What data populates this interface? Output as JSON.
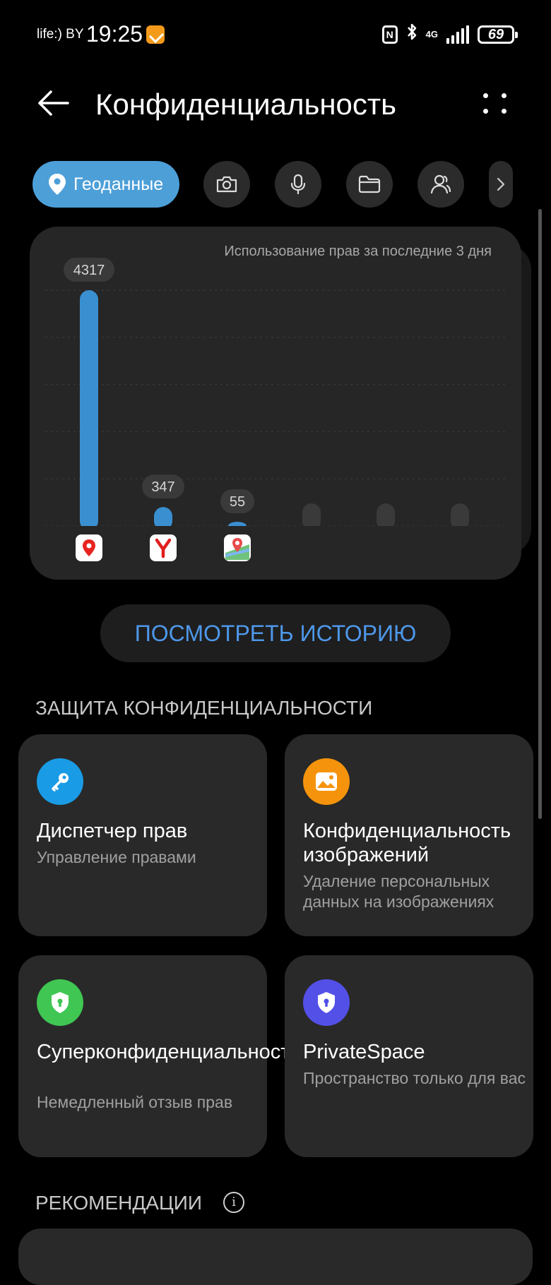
{
  "status_bar": {
    "carrier": "life:) BY",
    "time": "19:25",
    "network": "4G",
    "battery": "69"
  },
  "header": {
    "title": "Конфиденциальность"
  },
  "permission_tabs": {
    "active_label": "Геоданные",
    "items": [
      {
        "name": "location",
        "icon": "location-pin-icon",
        "active": true
      },
      {
        "name": "camera",
        "icon": "camera-icon"
      },
      {
        "name": "microphone",
        "icon": "microphone-icon"
      },
      {
        "name": "files",
        "icon": "folder-icon"
      },
      {
        "name": "contacts",
        "icon": "person-icon"
      }
    ]
  },
  "usage_chart": {
    "caption": "Использование прав за последние 3 дня",
    "bar_color": "#3a8fd0",
    "empty_bar_color": "#3a3a3a"
  },
  "chart_data": {
    "type": "bar",
    "title": "Использование прав за последние 3 дня",
    "categories": [
      "app-1-maps-pin",
      "app-2-yandex",
      "app-3-maps",
      "empty-4",
      "empty-5",
      "empty-6"
    ],
    "values": [
      4317,
      347,
      55,
      0,
      0,
      0
    ],
    "value_labels": [
      "4317",
      "347",
      "55",
      "",
      "",
      ""
    ],
    "ylim": [
      0,
      4317
    ],
    "grid": true
  },
  "history_button": {
    "label": "ПОСМОТРЕТЬ ИСТОРИЮ",
    "color": "#4e98ea"
  },
  "privacy_section": {
    "title": "ЗАЩИТА КОНФИДЕНЦИАЛЬНОСТИ",
    "tiles": [
      {
        "title": "Диспетчер прав",
        "subtitle": "Управление правами",
        "icon": "key-icon",
        "color": "#1a9be6"
      },
      {
        "title": "Конфиденциальность изображений",
        "subtitle": "Удаление персональных данных на изображениях",
        "icon": "image-icon",
        "color": "#f5940c"
      },
      {
        "title": "Суперконфиденциальность",
        "subtitle": "Немедленный отзыв прав",
        "icon": "shield-lock-icon",
        "color": "#3fc653"
      },
      {
        "title": "PrivateSpace",
        "subtitle": "Пространство только для вас",
        "icon": "shield-lock-icon",
        "color": "#5350e8"
      }
    ]
  },
  "recommendations": {
    "title": "РЕКОМЕНДАЦИИ",
    "info_icon": "i"
  }
}
